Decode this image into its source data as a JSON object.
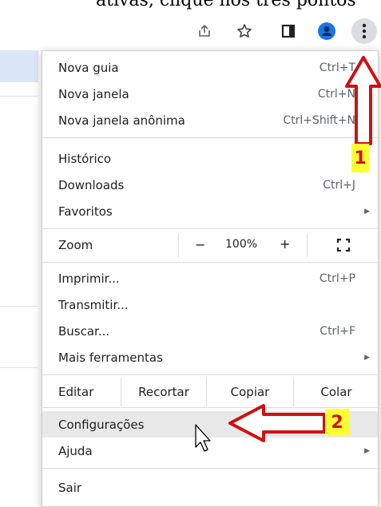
{
  "caption": "ativas, clique nos tres pontos",
  "toolbar": {
    "icons": [
      "share-icon",
      "star-icon",
      "side-panel-icon",
      "profile-icon",
      "kebab-menu-icon"
    ]
  },
  "menu": {
    "groups": [
      [
        {
          "label": "Nova guia",
          "shortcut": "Ctrl+T"
        },
        {
          "label": "Nova janela",
          "shortcut": "Ctrl+N"
        },
        {
          "label": "Nova janela anônima",
          "shortcut": "Ctrl+Shift+N"
        }
      ],
      [
        {
          "label": "Histórico",
          "shortcut": ""
        },
        {
          "label": "Downloads",
          "shortcut": "Ctrl+J"
        },
        {
          "label": "Favoritos",
          "shortcut": ""
        }
      ]
    ],
    "zoom": {
      "label": "Zoom",
      "minus": "−",
      "value": "100%",
      "plus": "+"
    },
    "tools": [
      {
        "label": "Imprimir...",
        "shortcut": "Ctrl+P"
      },
      {
        "label": "Transmitir...",
        "shortcut": ""
      },
      {
        "label": "Buscar...",
        "shortcut": "Ctrl+F"
      },
      {
        "label": "Mais ferramentas",
        "shortcut": ""
      }
    ],
    "edit": {
      "label": "Editar",
      "cut": "Recortar",
      "copy": "Copiar",
      "paste": "Colar"
    },
    "settings": {
      "label": "Configurações"
    },
    "help": {
      "label": "Ajuda"
    },
    "exit": {
      "label": "Sair"
    }
  },
  "annotations": {
    "step1": "1",
    "step2": "2",
    "color": "#d01010",
    "badge_color": "#ffff33"
  }
}
